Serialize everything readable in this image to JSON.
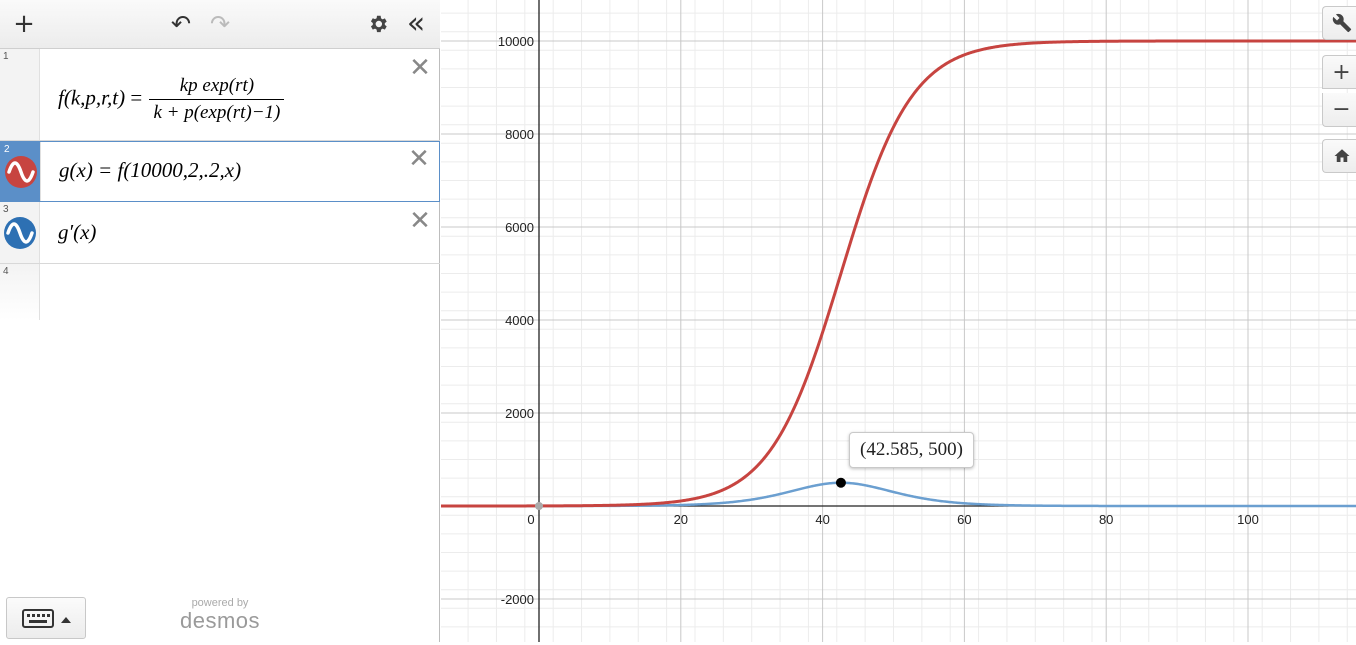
{
  "toolbar": {
    "add_icon": "+",
    "undo_icon": "↶",
    "redo_icon": "↷",
    "settings_icon": "gear-icon",
    "collapse_icon": "«"
  },
  "expressions": [
    {
      "index": "1",
      "lhs": "f",
      "args": "(k,p,r,t)",
      "equals": "=",
      "numerator": "kp exp(rt)",
      "denominator": "k + p(exp(rt)−1)",
      "color": null
    },
    {
      "index": "2",
      "text": "g(x) = f(10000,2,.2,x)",
      "color": "#c74440",
      "selected": true
    },
    {
      "index": "3",
      "text": "g′(x)",
      "color": "#2d70b3"
    },
    {
      "index": "4",
      "text": ""
    }
  ],
  "footer": {
    "powered_by": "powered by",
    "brand": "desmos",
    "keyboard_icon": "keyboard-icon"
  },
  "graph": {
    "x_ticks": [
      "0",
      "20",
      "40",
      "60",
      "80",
      "100"
    ],
    "y_ticks": [
      "10000",
      "8000",
      "6000",
      "4000",
      "2000",
      "-2000"
    ],
    "point_label": "(42.585, 500)",
    "controls": [
      "wrench-icon",
      "zoom-in-icon",
      "zoom-out-icon",
      "home-icon"
    ],
    "colors": {
      "red": "#c74440",
      "blue": "#6b9fd0"
    }
  },
  "chart_data": {
    "type": "line",
    "series": [
      {
        "name": "g(x)",
        "function": "10000*2*exp(0.2x)/(10000+2*(exp(0.2x)-1))"
      },
      {
        "name": "g′(x)",
        "function": "derivative of g(x)"
      }
    ],
    "highlighted_point": {
      "x": 42.585,
      "y": 500
    },
    "xlim": [
      -14,
      115
    ],
    "ylim": [
      -2900,
      10900
    ],
    "grid": true
  }
}
